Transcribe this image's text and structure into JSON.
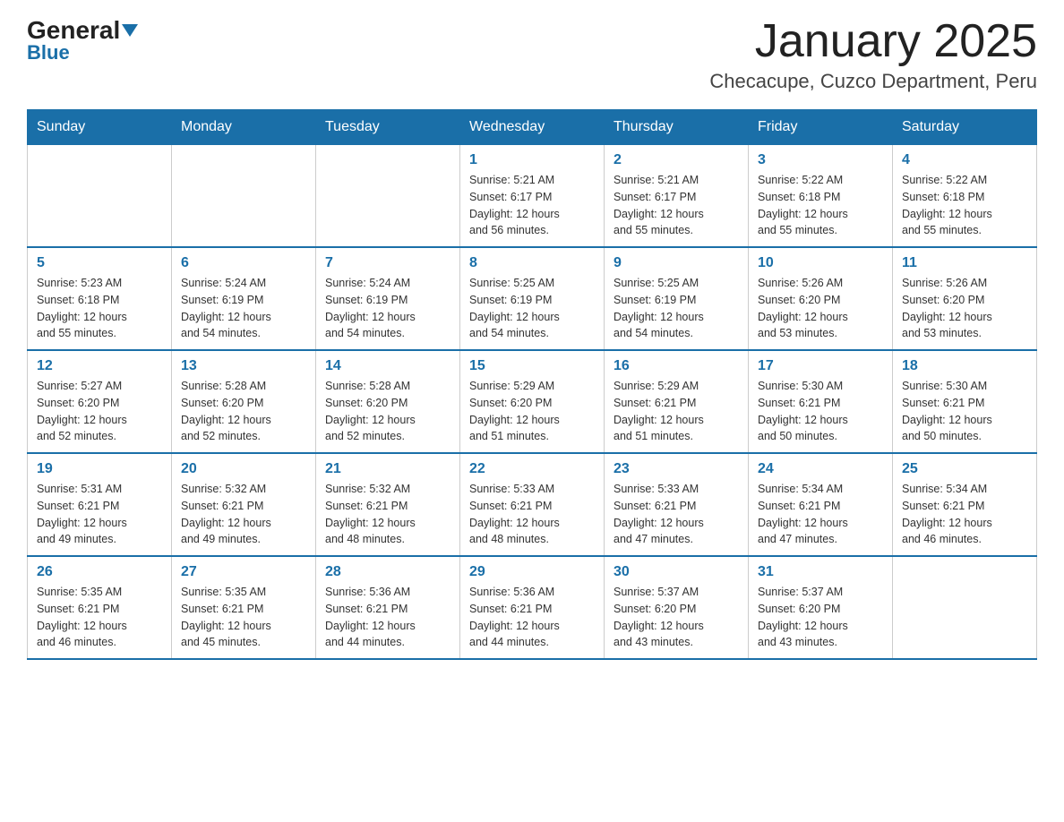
{
  "header": {
    "logo_general": "General",
    "logo_blue": "Blue",
    "title": "January 2025",
    "subtitle": "Checacupe, Cuzco Department, Peru"
  },
  "weekdays": [
    "Sunday",
    "Monday",
    "Tuesday",
    "Wednesday",
    "Thursday",
    "Friday",
    "Saturday"
  ],
  "weeks": [
    [
      {
        "day": "",
        "info": ""
      },
      {
        "day": "",
        "info": ""
      },
      {
        "day": "",
        "info": ""
      },
      {
        "day": "1",
        "info": "Sunrise: 5:21 AM\nSunset: 6:17 PM\nDaylight: 12 hours\nand 56 minutes."
      },
      {
        "day": "2",
        "info": "Sunrise: 5:21 AM\nSunset: 6:17 PM\nDaylight: 12 hours\nand 55 minutes."
      },
      {
        "day": "3",
        "info": "Sunrise: 5:22 AM\nSunset: 6:18 PM\nDaylight: 12 hours\nand 55 minutes."
      },
      {
        "day": "4",
        "info": "Sunrise: 5:22 AM\nSunset: 6:18 PM\nDaylight: 12 hours\nand 55 minutes."
      }
    ],
    [
      {
        "day": "5",
        "info": "Sunrise: 5:23 AM\nSunset: 6:18 PM\nDaylight: 12 hours\nand 55 minutes."
      },
      {
        "day": "6",
        "info": "Sunrise: 5:24 AM\nSunset: 6:19 PM\nDaylight: 12 hours\nand 54 minutes."
      },
      {
        "day": "7",
        "info": "Sunrise: 5:24 AM\nSunset: 6:19 PM\nDaylight: 12 hours\nand 54 minutes."
      },
      {
        "day": "8",
        "info": "Sunrise: 5:25 AM\nSunset: 6:19 PM\nDaylight: 12 hours\nand 54 minutes."
      },
      {
        "day": "9",
        "info": "Sunrise: 5:25 AM\nSunset: 6:19 PM\nDaylight: 12 hours\nand 54 minutes."
      },
      {
        "day": "10",
        "info": "Sunrise: 5:26 AM\nSunset: 6:20 PM\nDaylight: 12 hours\nand 53 minutes."
      },
      {
        "day": "11",
        "info": "Sunrise: 5:26 AM\nSunset: 6:20 PM\nDaylight: 12 hours\nand 53 minutes."
      }
    ],
    [
      {
        "day": "12",
        "info": "Sunrise: 5:27 AM\nSunset: 6:20 PM\nDaylight: 12 hours\nand 52 minutes."
      },
      {
        "day": "13",
        "info": "Sunrise: 5:28 AM\nSunset: 6:20 PM\nDaylight: 12 hours\nand 52 minutes."
      },
      {
        "day": "14",
        "info": "Sunrise: 5:28 AM\nSunset: 6:20 PM\nDaylight: 12 hours\nand 52 minutes."
      },
      {
        "day": "15",
        "info": "Sunrise: 5:29 AM\nSunset: 6:20 PM\nDaylight: 12 hours\nand 51 minutes."
      },
      {
        "day": "16",
        "info": "Sunrise: 5:29 AM\nSunset: 6:21 PM\nDaylight: 12 hours\nand 51 minutes."
      },
      {
        "day": "17",
        "info": "Sunrise: 5:30 AM\nSunset: 6:21 PM\nDaylight: 12 hours\nand 50 minutes."
      },
      {
        "day": "18",
        "info": "Sunrise: 5:30 AM\nSunset: 6:21 PM\nDaylight: 12 hours\nand 50 minutes."
      }
    ],
    [
      {
        "day": "19",
        "info": "Sunrise: 5:31 AM\nSunset: 6:21 PM\nDaylight: 12 hours\nand 49 minutes."
      },
      {
        "day": "20",
        "info": "Sunrise: 5:32 AM\nSunset: 6:21 PM\nDaylight: 12 hours\nand 49 minutes."
      },
      {
        "day": "21",
        "info": "Sunrise: 5:32 AM\nSunset: 6:21 PM\nDaylight: 12 hours\nand 48 minutes."
      },
      {
        "day": "22",
        "info": "Sunrise: 5:33 AM\nSunset: 6:21 PM\nDaylight: 12 hours\nand 48 minutes."
      },
      {
        "day": "23",
        "info": "Sunrise: 5:33 AM\nSunset: 6:21 PM\nDaylight: 12 hours\nand 47 minutes."
      },
      {
        "day": "24",
        "info": "Sunrise: 5:34 AM\nSunset: 6:21 PM\nDaylight: 12 hours\nand 47 minutes."
      },
      {
        "day": "25",
        "info": "Sunrise: 5:34 AM\nSunset: 6:21 PM\nDaylight: 12 hours\nand 46 minutes."
      }
    ],
    [
      {
        "day": "26",
        "info": "Sunrise: 5:35 AM\nSunset: 6:21 PM\nDaylight: 12 hours\nand 46 minutes."
      },
      {
        "day": "27",
        "info": "Sunrise: 5:35 AM\nSunset: 6:21 PM\nDaylight: 12 hours\nand 45 minutes."
      },
      {
        "day": "28",
        "info": "Sunrise: 5:36 AM\nSunset: 6:21 PM\nDaylight: 12 hours\nand 44 minutes."
      },
      {
        "day": "29",
        "info": "Sunrise: 5:36 AM\nSunset: 6:21 PM\nDaylight: 12 hours\nand 44 minutes."
      },
      {
        "day": "30",
        "info": "Sunrise: 5:37 AM\nSunset: 6:20 PM\nDaylight: 12 hours\nand 43 minutes."
      },
      {
        "day": "31",
        "info": "Sunrise: 5:37 AM\nSunset: 6:20 PM\nDaylight: 12 hours\nand 43 minutes."
      },
      {
        "day": "",
        "info": ""
      }
    ]
  ]
}
